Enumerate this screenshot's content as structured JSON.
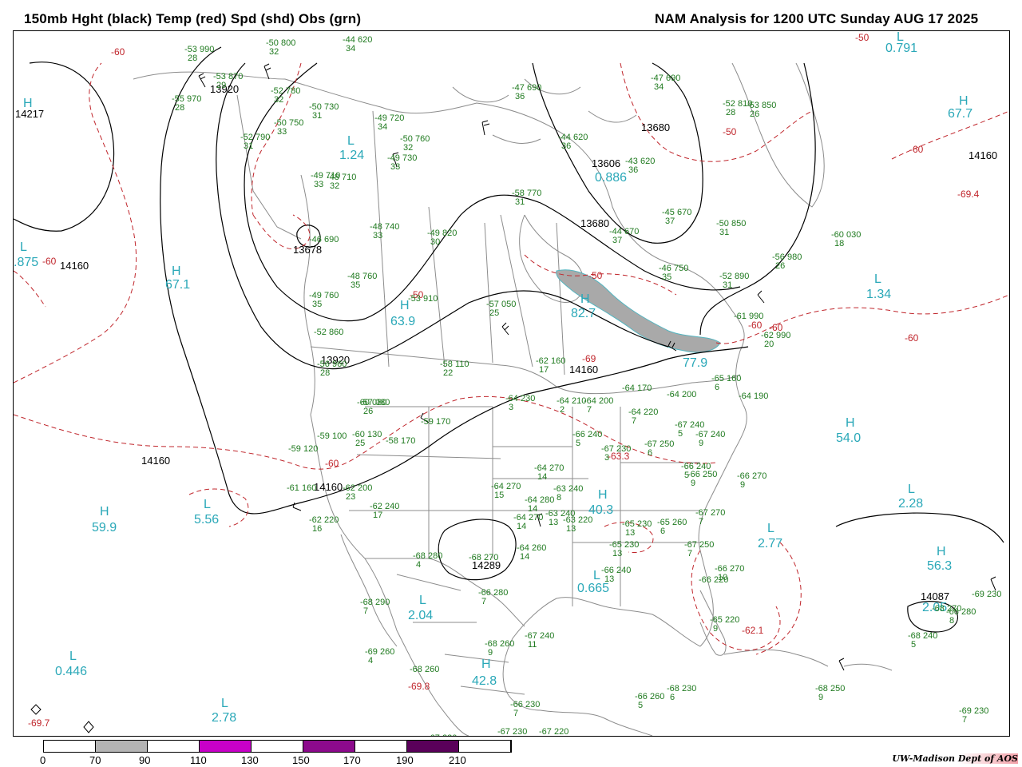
{
  "header": {
    "left_title": "150mb Hght (black) Temp (red) Spd (shd) Obs (grn)",
    "right_title": "NAM Analysis for 1200 UTC Sunday  AUG 17 2025"
  },
  "colors": {
    "height_contours": "#000000",
    "temp_contours": "#c0262c",
    "speed_shading": "#a9a9a9",
    "observations": "#1f7a1f",
    "centers": "#2aa8b8",
    "borders": "#8c8c8c"
  },
  "legend": {
    "title": "Spd (shd)",
    "bins": [
      {
        "from": "0",
        "color": "#ffffff"
      },
      {
        "from": "70",
        "color": "#b4b4b4"
      },
      {
        "from": "90",
        "color": "#ffffff"
      },
      {
        "from": "110",
        "color": "#c800c8"
      },
      {
        "from": "130",
        "color": "#ffffff"
      },
      {
        "from": "150",
        "color": "#8c0a8c"
      },
      {
        "from": "170",
        "color": "#ffffff"
      },
      {
        "from": "190",
        "color": "#5a005a"
      },
      {
        "from": "210",
        "color": "#ffffff"
      }
    ],
    "labels": [
      "0",
      "70",
      "90",
      "110",
      "130",
      "150",
      "170",
      "190",
      "210"
    ]
  },
  "height_labels": [
    "13920",
    "14217",
    "14160",
    "13680",
    "13606",
    "13680",
    "13678",
    "14160",
    "13920",
    "14160",
    "14160",
    "14160",
    "14289",
    "14087"
  ],
  "temp_labels": [
    "-60",
    "-50",
    "-50",
    "-60",
    "-60",
    "-69",
    "-50",
    "-60",
    "-60",
    "-60",
    "-69.4",
    "-63.3",
    "-62.1",
    "-69.8",
    "-69.7",
    "-60",
    "-50"
  ],
  "centers": [
    {
      "type": "H",
      "value": "",
      "id": "h-west-edge"
    },
    {
      "type": "L",
      "value": "1.24"
    },
    {
      "type": "L",
      "value": "0.886"
    },
    {
      "type": "L",
      "value": "0.791"
    },
    {
      "type": "H",
      "value": "67.7"
    },
    {
      "type": "L",
      "value": ".875"
    },
    {
      "type": "H",
      "value": "67.1"
    },
    {
      "type": "H",
      "value": "63.9"
    },
    {
      "type": "H",
      "value": "82.7"
    },
    {
      "type": "L",
      "value": "1.34"
    },
    {
      "type": "H",
      "value": "54.0"
    },
    {
      "type": "L",
      "value": "2.28"
    },
    {
      "type": "H",
      "value": "59.9"
    },
    {
      "type": "L",
      "value": "5.56"
    },
    {
      "type": "H",
      "value": "40.3"
    },
    {
      "type": "L",
      "value": "2.77"
    },
    {
      "type": "H",
      "value": "56.3"
    },
    {
      "type": "L",
      "value": "0.665"
    },
    {
      "type": "L",
      "value": "2.04"
    },
    {
      "type": "L",
      "value": "0.446"
    },
    {
      "type": "H",
      "value": "42.8"
    },
    {
      "type": "L",
      "value": "2.78"
    },
    {
      "type": "L",
      "value": "2.05"
    },
    {
      "type": "H",
      "value": "77.9"
    }
  ],
  "observations": [
    {
      "t": "-53",
      "z": "990",
      "s": "28"
    },
    {
      "t": "-50",
      "z": "800",
      "s": "32"
    },
    {
      "t": "-44",
      "z": "620",
      "s": "34"
    },
    {
      "t": "-53",
      "z": "870",
      "s": "29"
    },
    {
      "t": "-55",
      "z": "970",
      "s": "28"
    },
    {
      "t": "-52",
      "z": "780",
      "s": "32"
    },
    {
      "t": "-50",
      "z": "730",
      "s": "31"
    },
    {
      "t": "-50",
      "z": "750",
      "s": "33"
    },
    {
      "t": "-52",
      "z": "790",
      "s": "31"
    },
    {
      "t": "-49",
      "z": "720",
      "s": "34"
    },
    {
      "t": "-47",
      "z": "690",
      "s": "36"
    },
    {
      "t": "-50",
      "z": "760",
      "s": "32"
    },
    {
      "t": "-44",
      "z": "620",
      "s": "36"
    },
    {
      "t": "-43",
      "z": "620",
      "s": "36"
    },
    {
      "t": "-47",
      "z": "690",
      "s": "34"
    },
    {
      "t": "-52",
      "z": "810",
      "s": "28"
    },
    {
      "t": "-53",
      "z": "850",
      "s": "26"
    },
    {
      "t": "-49",
      "z": "730",
      "s": "33"
    },
    {
      "t": "-49",
      "z": "710",
      "s": "33"
    },
    {
      "t": "-48",
      "z": "710",
      "s": "32"
    },
    {
      "t": "-58",
      "z": "770",
      "s": "31"
    },
    {
      "t": "-45",
      "z": "670",
      "s": "37"
    },
    {
      "t": "-44",
      "z": "670",
      "s": "37"
    },
    {
      "t": "-50",
      "z": "850",
      "s": "31"
    },
    {
      "t": "-60",
      "z": "030",
      "s": "18"
    },
    {
      "t": "-48",
      "z": "740",
      "s": "33"
    },
    {
      "t": "-49",
      "z": "820",
      "s": "30"
    },
    {
      "t": "-46",
      "z": "690",
      "s": ""
    },
    {
      "t": "-56",
      "z": "980",
      "s": "26"
    },
    {
      "t": "-46",
      "z": "750",
      "s": "35"
    },
    {
      "t": "-52",
      "z": "890",
      "s": "31"
    },
    {
      "t": "-48",
      "z": "760",
      "s": "35"
    },
    {
      "t": "-49",
      "z": "760",
      "s": "35"
    },
    {
      "t": "-53",
      "z": "910",
      "s": ""
    },
    {
      "t": "-57",
      "z": "050",
      "s": "25"
    },
    {
      "t": "-61",
      "z": "990",
      "s": ""
    },
    {
      "t": "-62",
      "z": "990",
      "s": "20"
    },
    {
      "t": "-52",
      "z": "860",
      "s": ""
    },
    {
      "t": "-60",
      "z": "080",
      "s": ""
    },
    {
      "t": "-56",
      "z": "960",
      "s": "28"
    },
    {
      "t": "-58",
      "z": "110",
      "s": "22"
    },
    {
      "t": "-62",
      "z": "160",
      "s": "17"
    },
    {
      "t": "-65",
      "z": "160",
      "s": "6"
    },
    {
      "t": "-64",
      "z": "230",
      "s": "3"
    },
    {
      "t": "-64",
      "z": "210",
      "s": "2"
    },
    {
      "t": "-64",
      "z": "200",
      "s": "7"
    },
    {
      "t": "-64",
      "z": "170",
      "s": ""
    },
    {
      "t": "-64",
      "z": "200",
      "s": ""
    },
    {
      "t": "-64",
      "z": "190",
      "s": ""
    },
    {
      "t": "-57",
      "z": "080",
      "s": "26"
    },
    {
      "t": "-59",
      "z": "170",
      "s": ""
    },
    {
      "t": "-60",
      "z": "130",
      "s": "25"
    },
    {
      "t": "-58",
      "z": "170",
      "s": ""
    },
    {
      "t": "-59",
      "z": "100",
      "s": ""
    },
    {
      "t": "-59",
      "z": "120",
      "s": ""
    },
    {
      "t": "-64",
      "z": "220",
      "s": "7"
    },
    {
      "t": "-66",
      "z": "240",
      "s": "5"
    },
    {
      "t": "-67",
      "z": "240",
      "s": "5"
    },
    {
      "t": "-67",
      "z": "240",
      "s": "9"
    },
    {
      "t": "-67",
      "z": "230",
      "s": "3"
    },
    {
      "t": "-67",
      "z": "250",
      "s": "6"
    },
    {
      "t": "-66",
      "z": "240",
      "s": "5"
    },
    {
      "t": "-66",
      "z": "250",
      "s": "9"
    },
    {
      "t": "-66",
      "z": "270",
      "s": "9"
    },
    {
      "t": "-64",
      "z": "270",
      "s": "14"
    },
    {
      "t": "-64",
      "z": "270",
      "s": "15"
    },
    {
      "t": "-63",
      "z": "240",
      "s": "8"
    },
    {
      "t": "-63",
      "z": "240",
      "s": "13"
    },
    {
      "t": "-61",
      "z": "160",
      "s": ""
    },
    {
      "t": "-62",
      "z": "200",
      "s": "23"
    },
    {
      "t": "-62",
      "z": "240",
      "s": "17"
    },
    {
      "t": "-62",
      "z": "220",
      "s": "16"
    },
    {
      "t": "-64",
      "z": "280",
      "s": "14"
    },
    {
      "t": "-64",
      "z": "270",
      "s": "14"
    },
    {
      "t": "-63",
      "z": "220",
      "s": "13"
    },
    {
      "t": "-65",
      "z": "230",
      "s": "13"
    },
    {
      "t": "-65",
      "z": "260",
      "s": "6"
    },
    {
      "t": "-67",
      "z": "270",
      "s": "7"
    },
    {
      "t": "-67",
      "z": "250",
      "s": "7"
    },
    {
      "t": "-66",
      "z": "270",
      "s": "10"
    },
    {
      "t": "-66",
      "z": "220",
      "s": ""
    },
    {
      "t": "-65",
      "z": "230",
      "s": "13"
    },
    {
      "t": "-64",
      "z": "260",
      "s": "14"
    },
    {
      "t": "-66",
      "z": "240",
      "s": "13"
    },
    {
      "t": "-68",
      "z": "280",
      "s": "4"
    },
    {
      "t": "-68",
      "z": "270",
      "s": ""
    },
    {
      "t": "-66",
      "z": "280",
      "s": "7"
    },
    {
      "t": "-68",
      "z": "290",
      "s": "7"
    },
    {
      "t": "-69",
      "z": "260",
      "s": "4"
    },
    {
      "t": "-68",
      "z": "260",
      "s": "9"
    },
    {
      "t": "-67",
      "z": "240",
      "s": "11"
    },
    {
      "t": "-68",
      "z": "260",
      "s": ""
    },
    {
      "t": "-65",
      "z": "220",
      "s": "9"
    },
    {
      "t": "-66",
      "z": "230",
      "s": "7"
    },
    {
      "t": "-66",
      "z": "260",
      "s": "5"
    },
    {
      "t": "-68",
      "z": "230",
      "s": "6"
    },
    {
      "t": "-68",
      "z": "250",
      "s": "9"
    },
    {
      "t": "-67",
      "z": "230",
      "s": ""
    },
    {
      "t": "-67",
      "z": "230",
      "s": ""
    },
    {
      "t": "-67",
      "z": "220",
      "s": ""
    },
    {
      "t": "-68",
      "z": "240",
      "s": "5"
    },
    {
      "t": "-66",
      "z": "280",
      "s": "8"
    },
    {
      "t": "-69",
      "z": "230",
      "s": "7"
    },
    {
      "t": "-69",
      "z": "230",
      "s": ""
    },
    {
      "t": "-68",
      "z": "270",
      "s": ""
    }
  ],
  "credit": {
    "org": "UW-Madison",
    "dept": "Dept of AOS"
  }
}
